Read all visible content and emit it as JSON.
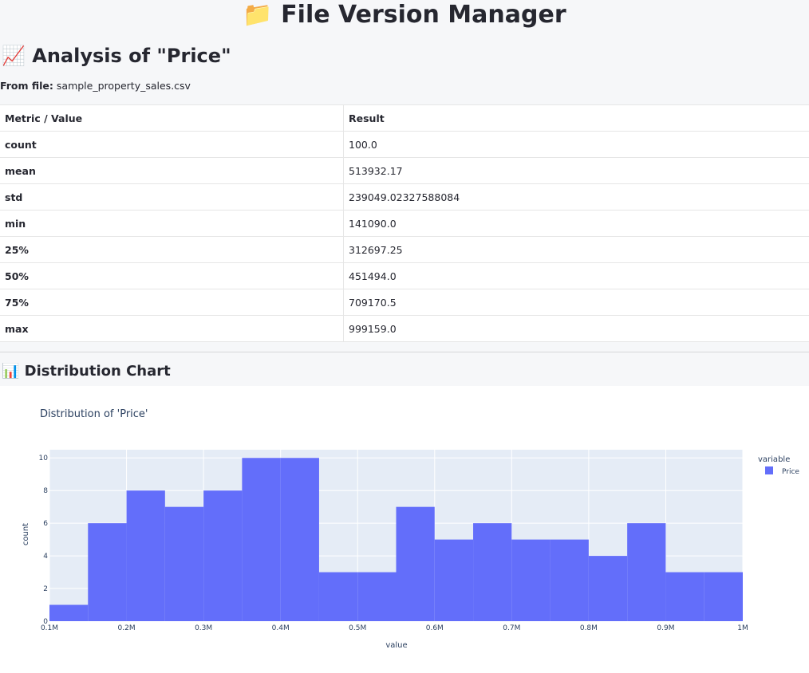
{
  "app": {
    "title": "📁 File Version Manager"
  },
  "analysis": {
    "title": "📈 Analysis of \"Price\"",
    "from_file_label": "From file:",
    "file_name": "sample_property_sales.csv"
  },
  "table": {
    "headers": [
      "Metric / Value",
      "Result"
    ],
    "rows": [
      {
        "metric": "count",
        "result": "100.0"
      },
      {
        "metric": "mean",
        "result": "513932.17"
      },
      {
        "metric": "std",
        "result": "239049.02327588084"
      },
      {
        "metric": "min",
        "result": "141090.0"
      },
      {
        "metric": "25%",
        "result": "312697.25"
      },
      {
        "metric": "50%",
        "result": "451494.0"
      },
      {
        "metric": "75%",
        "result": "709170.5"
      },
      {
        "metric": "max",
        "result": "999159.0"
      }
    ]
  },
  "distribution": {
    "title": "📊 Distribution Chart"
  },
  "chart_data": {
    "type": "bar",
    "title": "Distribution of 'Price'",
    "xlabel": "value",
    "ylabel": "count",
    "bin_edges": [
      100000,
      150000,
      200000,
      250000,
      300000,
      350000,
      400000,
      450000,
      500000,
      550000,
      600000,
      650000,
      700000,
      750000,
      800000,
      850000,
      900000,
      950000,
      1000000
    ],
    "series": [
      {
        "name": "Price",
        "values": [
          1,
          6,
          8,
          7,
          8,
          10,
          10,
          3,
          3,
          7,
          5,
          6,
          5,
          5,
          4,
          6,
          3,
          3
        ]
      }
    ],
    "xlim": [
      100000,
      1000000
    ],
    "ylim": [
      0,
      10.5
    ],
    "xticks": [
      {
        "value": 100000,
        "label": "0.1M"
      },
      {
        "value": 200000,
        "label": "0.2M"
      },
      {
        "value": 300000,
        "label": "0.3M"
      },
      {
        "value": 400000,
        "label": "0.4M"
      },
      {
        "value": 500000,
        "label": "0.5M"
      },
      {
        "value": 600000,
        "label": "0.6M"
      },
      {
        "value": 700000,
        "label": "0.7M"
      },
      {
        "value": 800000,
        "label": "0.8M"
      },
      {
        "value": 900000,
        "label": "0.9M"
      },
      {
        "value": 1000000,
        "label": "1M"
      }
    ],
    "yticks": [
      0,
      2,
      4,
      6,
      8,
      10
    ],
    "legend_title": "variable",
    "legend_position": "top-right",
    "grid": true,
    "colors": {
      "bar": "#636efa",
      "plot_bg": "#e5ecf6",
      "grid": "#ffffff",
      "text": "#2a3f5f"
    }
  }
}
